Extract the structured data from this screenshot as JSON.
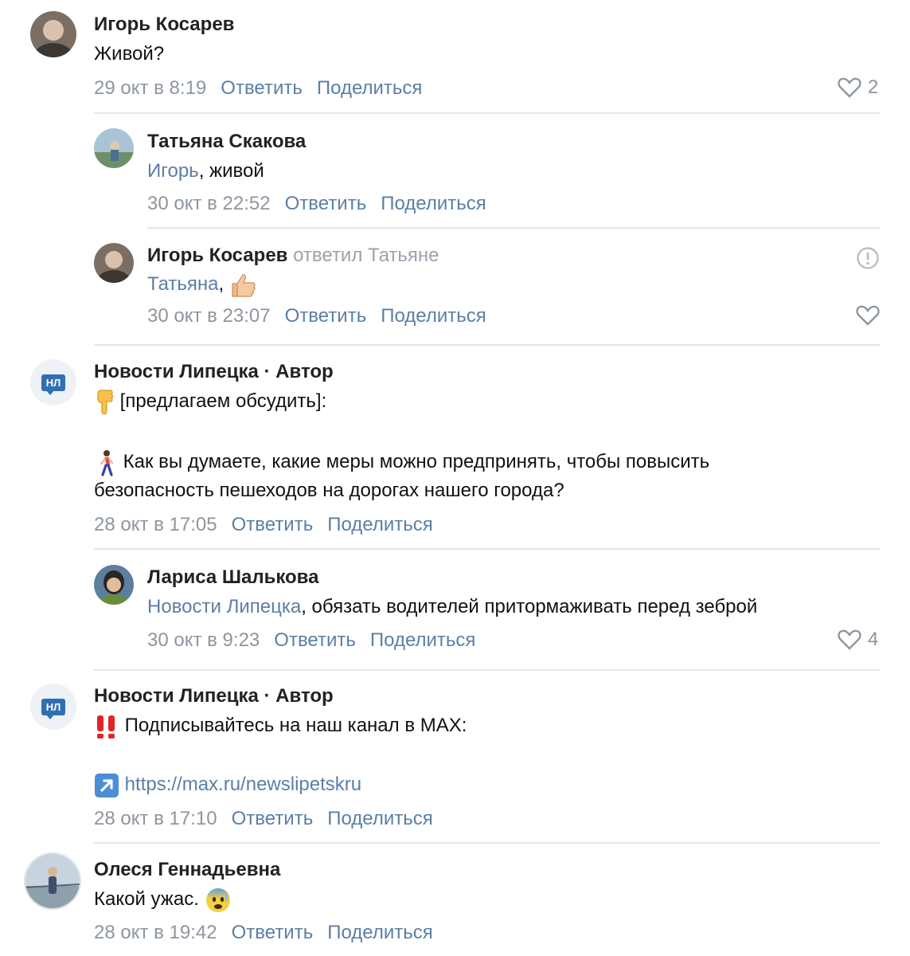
{
  "comments": [
    {
      "author": "Игорь Косарев",
      "text": "Живой?",
      "date": "29 окт в 8:19",
      "reply_label": "Ответить",
      "share_label": "Поделиться",
      "likes": "2"
    },
    {
      "author": "Татьяна Скакова",
      "mention": "Игорь",
      "text": ", живой",
      "date": "30 окт в 22:52",
      "reply_label": "Ответить",
      "share_label": "Поделиться"
    },
    {
      "author": "Игорь Косарев",
      "replied_to": "ответил Татьяне",
      "mention": "Татьяна",
      "text": ",",
      "date": "30 окт в 23:07",
      "reply_label": "Ответить",
      "share_label": "Поделиться"
    },
    {
      "author": "Новости Липецка · Автор",
      "badge": "НЛ",
      "line1": "[предлагаем обсудить]:",
      "line2": "Как вы думаете, какие меры можно предпринять, чтобы повысить",
      "line3": "безопасность пешеходов на дорогах нашего города?",
      "date": "28 окт в 17:05",
      "reply_label": "Ответить",
      "share_label": "Поделиться"
    },
    {
      "author": "Лариса Шалькова",
      "mention": "Новости Липецка",
      "text": ", обязать водителей притормаживать перед зеброй",
      "date": "30 окт в 9:23",
      "reply_label": "Ответить",
      "share_label": "Поделиться",
      "likes": "4"
    },
    {
      "author": "Новости Липецка · Автор",
      "badge": "НЛ",
      "line1": "Подписывайтесь на наш канал в MAX:",
      "link": "https://max.ru/newslipetskru",
      "date": "28 окт в 17:10",
      "reply_label": "Ответить",
      "share_label": "Поделиться"
    },
    {
      "author": "Олеся Геннадьевна",
      "text": "Какой ужас.",
      "date": "28 окт в 19:42",
      "reply_label": "Ответить",
      "share_label": "Поделиться"
    }
  ],
  "colors": {
    "link": "#5b7fa6",
    "meta": "#8d96a0",
    "divider": "#e4e6ea",
    "badge": "#2f6fb3"
  }
}
